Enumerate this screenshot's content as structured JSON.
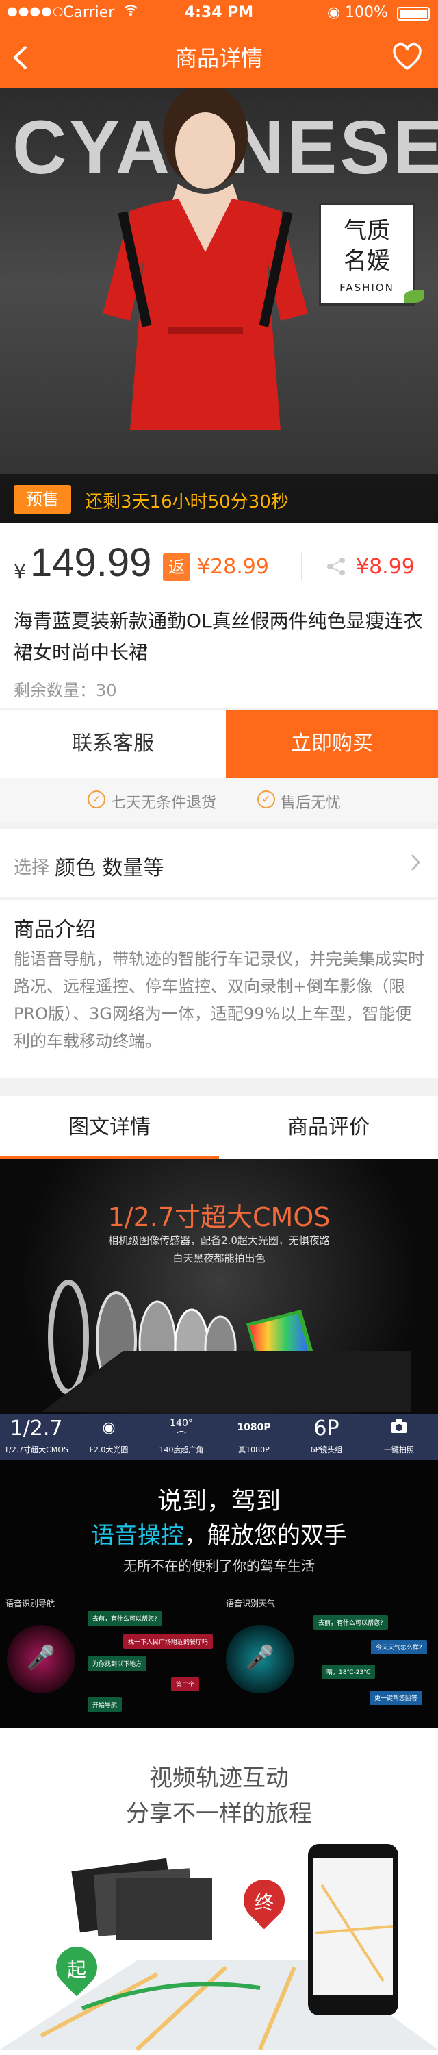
{
  "status": {
    "carrier": "Carrier",
    "time": "4:34 PM",
    "battery": "100%"
  },
  "nav": {
    "title": "商品详情"
  },
  "hero": {
    "brand": "CYANNESEA",
    "badge_line1": "气质",
    "badge_line2": "名媛",
    "badge_en": "FASHION",
    "presale_tag": "预售",
    "countdown": "还剩3天16小时50分30秒"
  },
  "price": {
    "currency": "¥",
    "amount": "149.99",
    "rebate_tag": "返",
    "rebate": "¥28.99",
    "share_price": "¥8.99"
  },
  "product": {
    "title": "海青蓝夏装新款通勤OL真丝假两件纯色显瘦连衣裙女时尚中长裙",
    "stock": "剩余数量：30"
  },
  "actions": {
    "contact": "联系客服",
    "buy": "立即购买"
  },
  "guarantees": [
    "七天无条件退货",
    "售后无忧"
  ],
  "select": {
    "label": "选择",
    "value": "颜色 数量等"
  },
  "intro": {
    "heading": "商品介绍",
    "text": "能语音导航，带轨迹的智能行车记录仪，并完美集成实时路况、远程遥控、停车监控、双向录制+倒车影像（限PRO版）、3G网络为一体，适配99%以上车型，智能便利的车载移动终端。"
  },
  "tabs": [
    "图文详情",
    "商品评价"
  ],
  "detail1": {
    "headline": "1/2.7寸超大CMOS",
    "sub1": "相机级图像传感器，配备2.0超大光圈，无惧夜路",
    "sub2": "白天黑夜都能拍出色"
  },
  "specs": [
    {
      "value": "1/2.7",
      "label": "1/2.7寸超大CMOS"
    },
    {
      "value": "F2.0",
      "label": "F2.0大光圈"
    },
    {
      "value": "140°",
      "label": "140度超广角"
    },
    {
      "value": "1080P",
      "label": "真1080P"
    },
    {
      "value": "6P",
      "label": "6P镜头组"
    },
    {
      "value": "",
      "label": "一键拍照"
    }
  ],
  "detail2": {
    "line1": "说到，驾到",
    "highlight": "语音操控",
    "line2": "，解放您的双手",
    "sub": "无所不在的便利了你的驾车生活",
    "left_title": "语音识别导航",
    "right_title": "语音识别天气",
    "left_chips": [
      "去前，有什么可以帮您?",
      "找一下人民广场附近的餐厅吗",
      "为你找到以下地方",
      "第二个",
      "开始导航"
    ],
    "right_chips": [
      "去前，有什么可以帮您?",
      "今天天气怎么样?",
      "晴，18℃-23℃",
      "更一键帮您回答"
    ]
  },
  "detail3": {
    "line1": "视频轨迹互动",
    "line2": "分享不一样的旅程",
    "start": "起",
    "end": "终"
  }
}
